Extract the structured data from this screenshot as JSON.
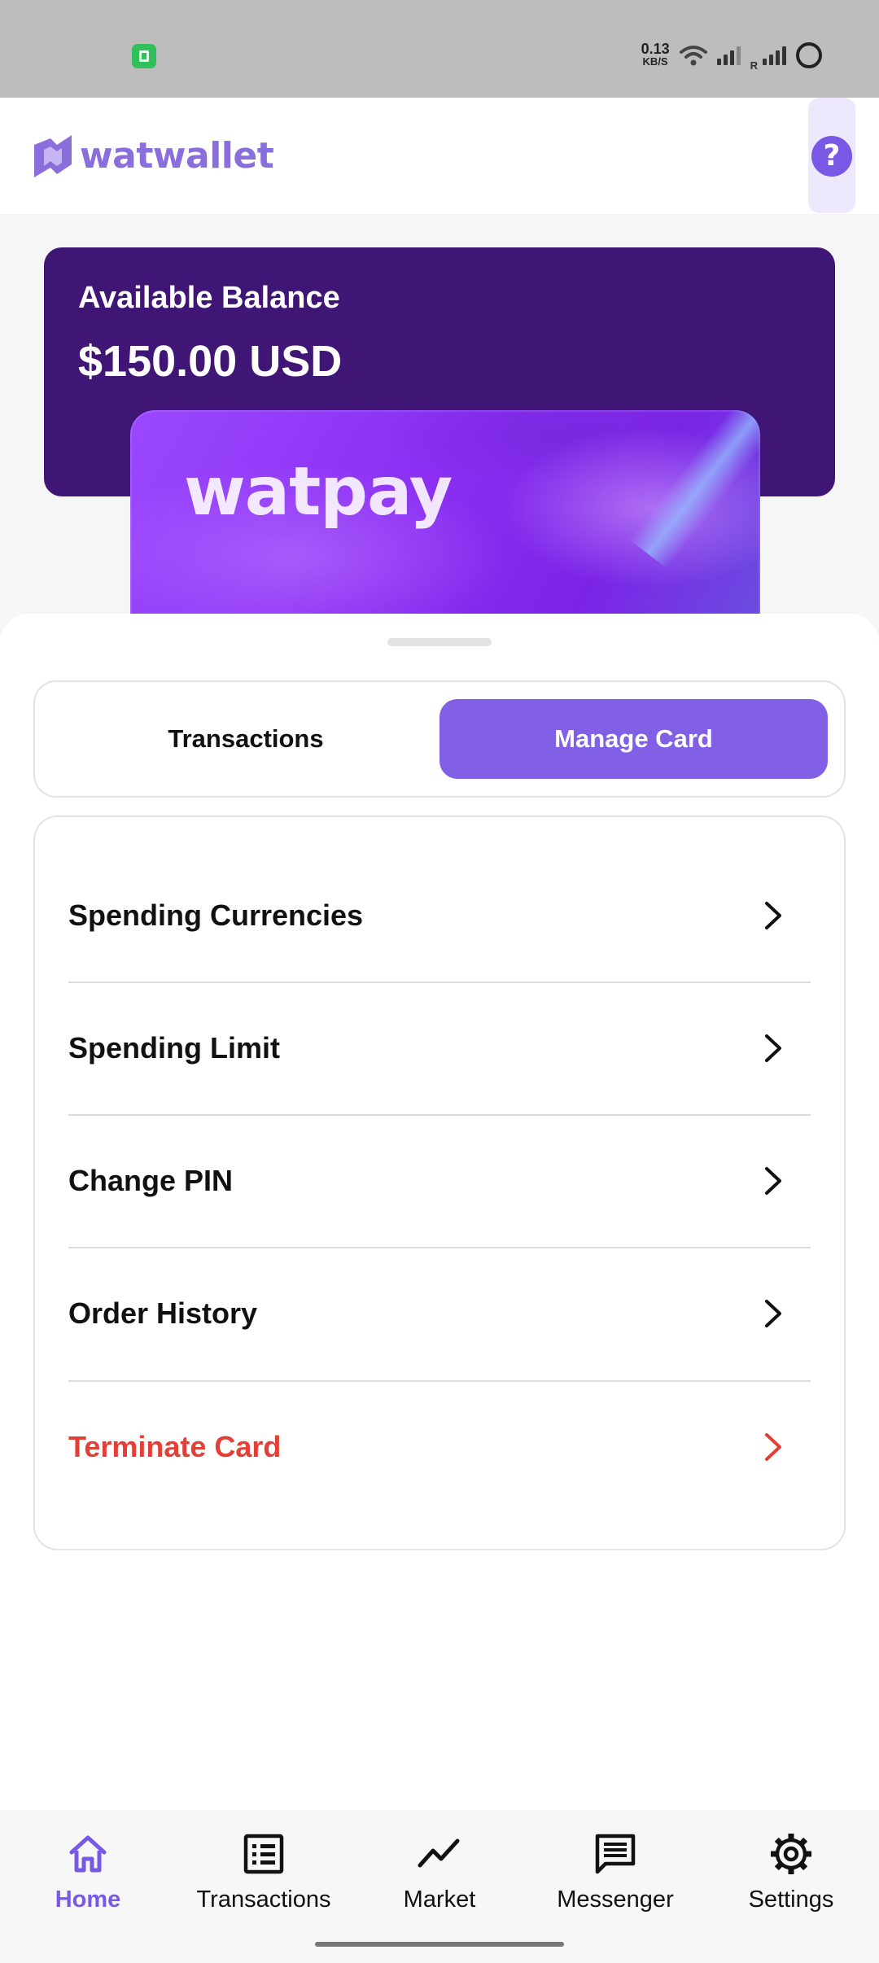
{
  "status_bar": {
    "net_speed_value": "0.13",
    "net_speed_unit": "KB/S",
    "roaming_label": "R"
  },
  "header": {
    "brand": "watwallet",
    "help_glyph": "?"
  },
  "balance": {
    "label": "Available Balance",
    "amount": "$150.00 USD"
  },
  "card": {
    "brand": "watpay"
  },
  "tabs": [
    {
      "label": "Transactions",
      "active": false
    },
    {
      "label": "Manage Card",
      "active": true
    }
  ],
  "menu": [
    {
      "label": "Spending Currencies",
      "icon": "chevron-right-icon"
    },
    {
      "label": "Spending Limit",
      "icon": "chevron-right-icon"
    },
    {
      "label": "Change PIN",
      "icon": "chevron-right-icon"
    },
    {
      "label": "Order History",
      "icon": "chevron-right-icon"
    },
    {
      "label": "Terminate Card",
      "icon": "chevron-right-icon",
      "danger": true
    }
  ],
  "bottom_nav": [
    {
      "label": "Home",
      "icon": "home-icon",
      "active": true
    },
    {
      "label": "Transactions",
      "icon": "list-icon",
      "active": false
    },
    {
      "label": "Market",
      "icon": "trend-icon",
      "active": false
    },
    {
      "label": "Messenger",
      "icon": "message-icon",
      "active": false
    },
    {
      "label": "Settings",
      "icon": "gear-icon",
      "active": false
    }
  ],
  "colors": {
    "accent": "#8160e6",
    "balance_bg": "#3f1576",
    "danger": "#e23f36",
    "status_bar_bg": "#bdbdbd"
  }
}
